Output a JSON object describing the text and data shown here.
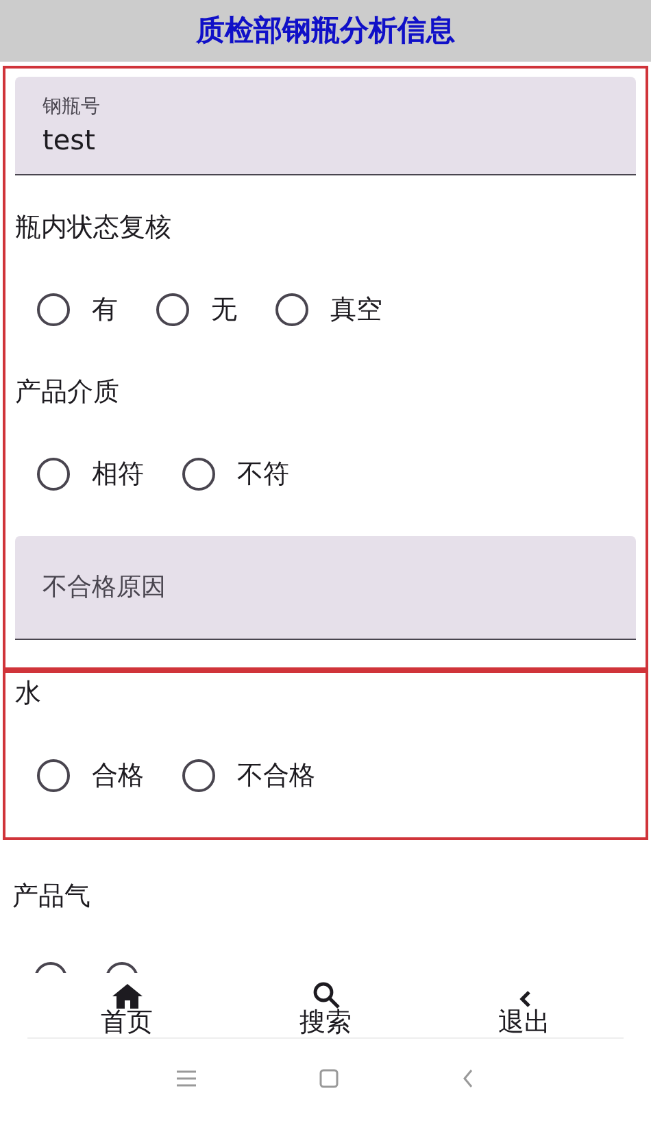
{
  "title": "质检部钢瓶分析信息",
  "groups": [
    {
      "highlighted": true,
      "items": [
        {
          "kind": "field",
          "label": "钢瓶号",
          "value": "test"
        },
        {
          "kind": "radio",
          "label": "瓶内状态复核",
          "options": [
            {
              "label": "有",
              "selected": false
            },
            {
              "label": "无",
              "selected": false
            },
            {
              "label": "真空",
              "selected": false
            }
          ]
        },
        {
          "kind": "radio",
          "label": "产品介质",
          "options": [
            {
              "label": "相符",
              "selected": false
            },
            {
              "label": "不符",
              "selected": false
            }
          ]
        },
        {
          "kind": "field",
          "placeholder": "不合格原因"
        }
      ]
    },
    {
      "highlighted": true,
      "items": [
        {
          "kind": "radio",
          "label": "水",
          "options": [
            {
              "label": "合格",
              "selected": false
            },
            {
              "label": "不合格",
              "selected": false
            }
          ]
        }
      ]
    },
    {
      "highlighted": false,
      "items": [
        {
          "kind": "radio",
          "label": "产品气",
          "options": [
            {
              "selected": false
            },
            {
              "selected": false
            }
          ]
        }
      ]
    }
  ],
  "bottom_nav": [
    {
      "label": "首页"
    },
    {
      "label": "搜索"
    },
    {
      "label": "退出"
    }
  ]
}
